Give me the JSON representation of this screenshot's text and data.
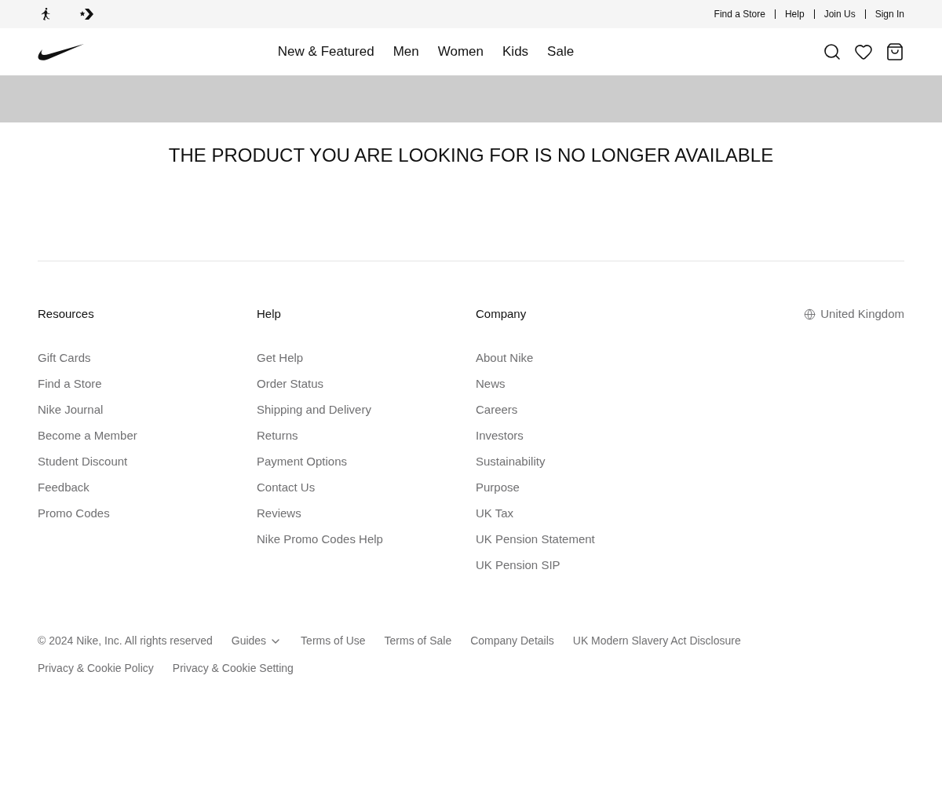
{
  "utility_bar": {
    "links": [
      "Find a Store",
      "Help",
      "Join Us",
      "Sign In"
    ]
  },
  "nav": {
    "items": [
      "New & Featured",
      "Men",
      "Women",
      "Kids",
      "Sale"
    ]
  },
  "message": "THE PRODUCT YOU ARE LOOKING FOR IS NO LONGER AVAILABLE",
  "footer": {
    "columns": [
      {
        "title": "Resources",
        "links": [
          "Gift Cards",
          "Find a Store",
          "Nike Journal",
          "Become a Member",
          "Student Discount",
          "Feedback",
          "Promo Codes"
        ]
      },
      {
        "title": "Help",
        "links": [
          "Get Help",
          "Order Status",
          "Shipping and Delivery",
          "Returns",
          "Payment Options",
          "Contact Us",
          "Reviews",
          "Nike Promo Codes Help"
        ]
      },
      {
        "title": "Company",
        "links": [
          "About Nike",
          "News",
          "Careers",
          "Investors",
          "Sustainability",
          "Purpose",
          "UK Tax",
          "UK Pension Statement",
          "UK Pension SIP"
        ]
      }
    ],
    "region": "United Kingdom",
    "legal_rows": [
      [
        {
          "kind": "text",
          "label": "© 2024 Nike, Inc. All rights reserved"
        },
        {
          "kind": "dropdown",
          "label": "Guides"
        },
        {
          "kind": "link",
          "label": "Terms of Use"
        },
        {
          "kind": "link",
          "label": "Terms of Sale"
        },
        {
          "kind": "link",
          "label": "Company Details"
        },
        {
          "kind": "link",
          "label": "UK Modern Slavery Act Disclosure"
        }
      ],
      [
        {
          "kind": "link",
          "label": "Privacy & Cookie Policy"
        },
        {
          "kind": "link",
          "label": "Privacy & Cookie Setting"
        }
      ]
    ]
  }
}
